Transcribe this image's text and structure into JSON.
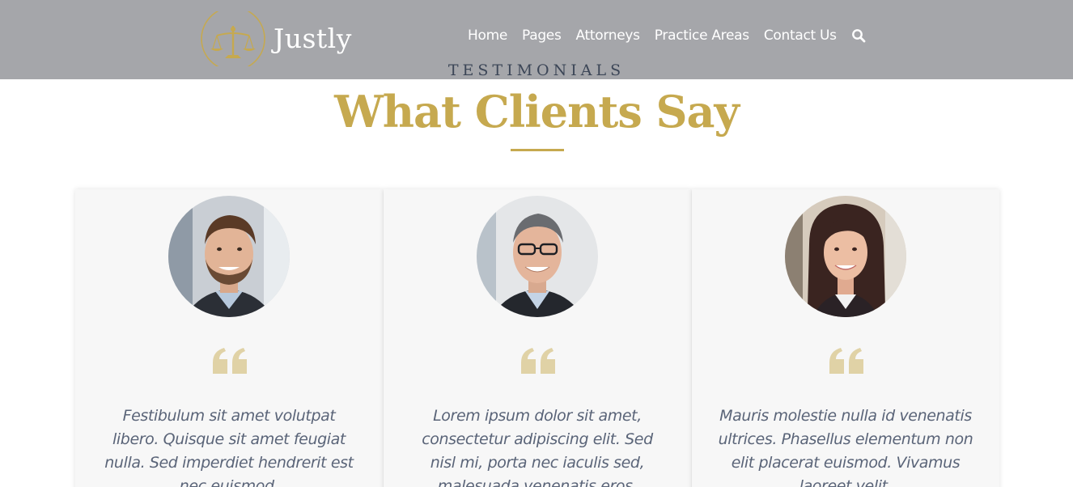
{
  "brand": {
    "name": "Justly"
  },
  "nav": {
    "items": [
      {
        "label": "Home"
      },
      {
        "label": "Pages"
      },
      {
        "label": "Attorneys"
      },
      {
        "label": "Practice Areas"
      },
      {
        "label": "Contact Us"
      }
    ],
    "search_icon": "search-icon"
  },
  "section": {
    "eyebrow": "TESTIMONIALS",
    "title": "What Clients Say"
  },
  "colors": {
    "header_bg": "#a5a6aa",
    "accent_gold": "#c6a94f",
    "quote_icon": "#e0d2a6",
    "card_bg": "#f7f7f7",
    "text_muted": "#5a6478"
  },
  "testimonials": [
    {
      "avatar": "man-with-beard-photo",
      "quote_icon": "quote-icon",
      "text": "Festibulum sit amet volutpat libero. Quisque sit amet feugiat nulla. Sed imperdiet hendrerit est nec euismod."
    },
    {
      "avatar": "older-man-with-glasses-photo",
      "quote_icon": "quote-icon",
      "text": "Lorem ipsum dolor sit amet, consectetur adipiscing elit. Sed nisl mi, porta nec iaculis sed, malesuada venenatis eros."
    },
    {
      "avatar": "woman-smiling-photo",
      "quote_icon": "quote-icon",
      "text": "Mauris molestie nulla id venenatis ultrices. Phasellus elementum non elit placerat euismod. Vivamus laoreet velit."
    }
  ]
}
